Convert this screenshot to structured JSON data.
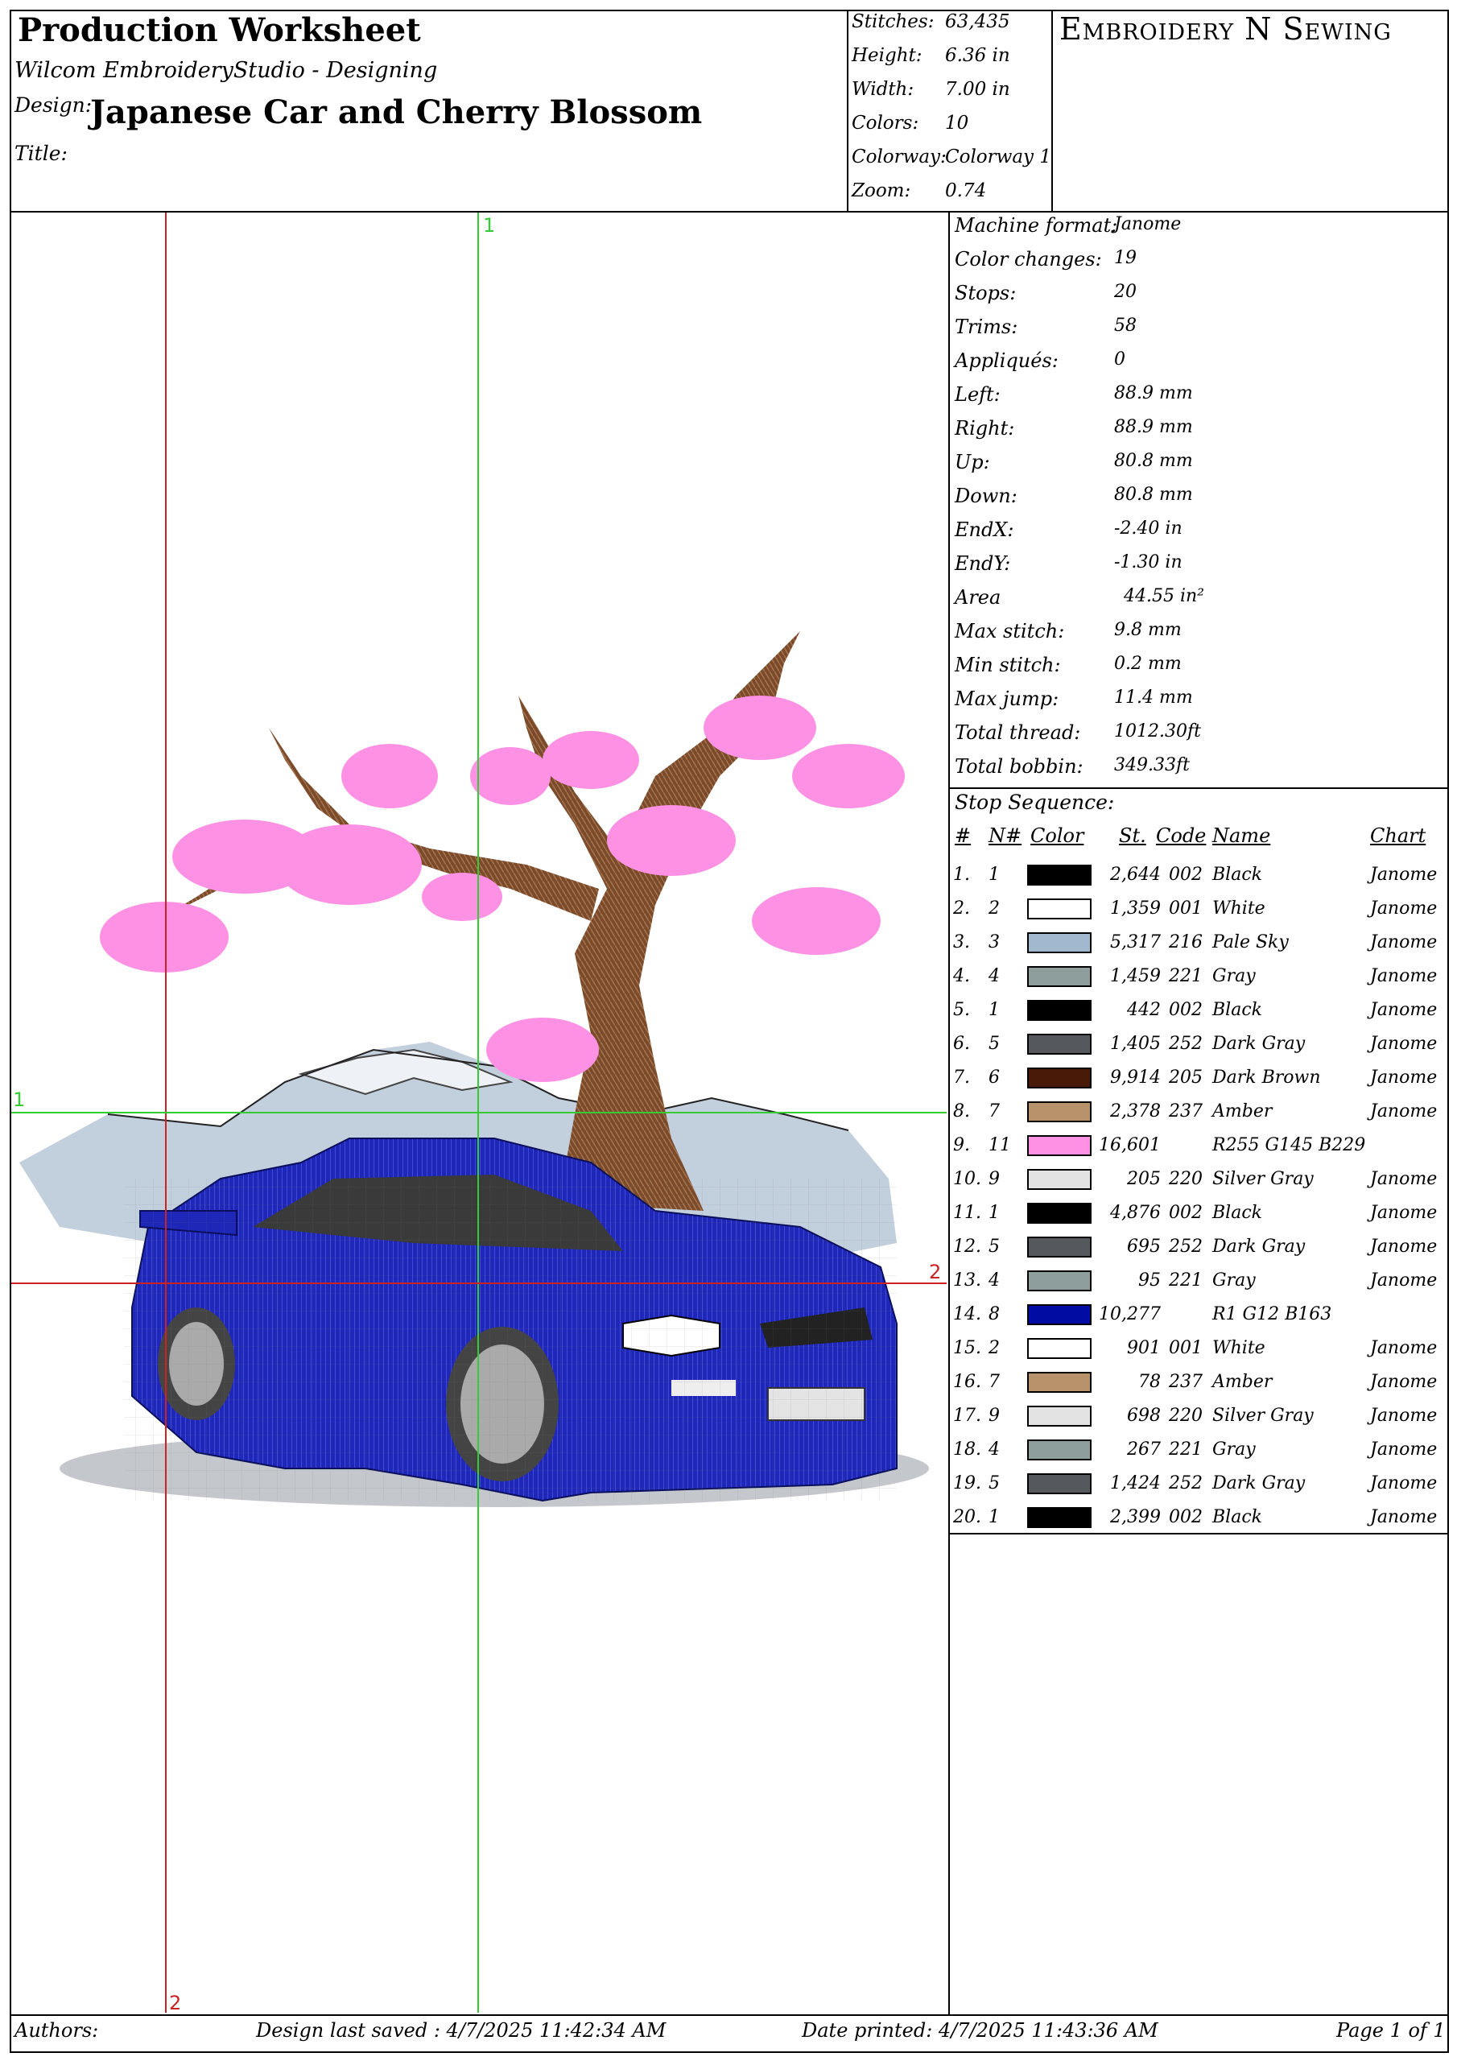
{
  "header": {
    "title": "Production Worksheet",
    "software": "Wilcom EmbroideryStudio - Designing",
    "design_label": "Design:",
    "design_name": "Japanese Car and Cherry Blossom",
    "title_label": "Title:",
    "brand": "Embroidery N Sewing"
  },
  "summary": [
    {
      "label": "Stitches:",
      "value": "63,435"
    },
    {
      "label": "Height:",
      "value": "6.36  in"
    },
    {
      "label": "Width:",
      "value": "7.00  in"
    },
    {
      "label": "Colors:",
      "value": "10"
    },
    {
      "label": "Colorway:",
      "value": "Colorway 1"
    },
    {
      "label": "Zoom:",
      "value": "0.74"
    }
  ],
  "machine_info": [
    {
      "label": "Machine format:",
      "value": "Janome"
    },
    {
      "label": "Color changes:",
      "value": "19"
    },
    {
      "label": "Stops:",
      "value": "20"
    },
    {
      "label": "Trims:",
      "value": "58"
    },
    {
      "label": "Appliqués:",
      "value": "0"
    },
    {
      "label": "Left:",
      "value": "88.9  mm"
    },
    {
      "label": "Right:",
      "value": "88.9  mm"
    },
    {
      "label": "Up:",
      "value": "80.8  mm"
    },
    {
      "label": "Down:",
      "value": "80.8  mm"
    },
    {
      "label": "EndX:",
      "value": "-2.40  in"
    },
    {
      "label": "EndY:",
      "value": "-1.30  in"
    },
    {
      "label": "Area",
      "value": "44.55  in²"
    },
    {
      "label": "Max stitch:",
      "value": "9.8  mm"
    },
    {
      "label": "Min stitch:",
      "value": "0.2  mm"
    },
    {
      "label": "Max jump:",
      "value": "11.4  mm"
    },
    {
      "label": "Total thread:",
      "value": "1012.30ft"
    },
    {
      "label": "Total bobbin:",
      "value": "349.33ft"
    }
  ],
  "stop_sequence": {
    "heading": "Stop Sequence:",
    "columns": {
      "idx": "#",
      "n": "N#",
      "color": "Color",
      "st": "St.",
      "code": "Code",
      "name": "Name",
      "chart": "Chart"
    },
    "rows": [
      {
        "idx": "1.",
        "n": "1",
        "color": "#000000",
        "st": "2,644",
        "code": "002",
        "name": "Black",
        "chart": "Janome"
      },
      {
        "idx": "2.",
        "n": "2",
        "color": "#ffffff",
        "st": "1,359",
        "code": "001",
        "name": "White",
        "chart": "Janome"
      },
      {
        "idx": "3.",
        "n": "3",
        "color": "#a0b9cf",
        "st": "5,317",
        "code": "216",
        "name": "Pale Sky",
        "chart": "Janome"
      },
      {
        "idx": "4.",
        "n": "4",
        "color": "#8e9e9c",
        "st": "1,459",
        "code": "221",
        "name": "Gray",
        "chart": "Janome"
      },
      {
        "idx": "5.",
        "n": "1",
        "color": "#000000",
        "st": "442",
        "code": "002",
        "name": "Black",
        "chart": "Janome"
      },
      {
        "idx": "6.",
        "n": "5",
        "color": "#55585c",
        "st": "1,405",
        "code": "252",
        "name": "Dark Gray",
        "chart": "Janome"
      },
      {
        "idx": "7.",
        "n": "6",
        "color": "#4a1a08",
        "st": "9,914",
        "code": "205",
        "name": "Dark Brown",
        "chart": "Janome"
      },
      {
        "idx": "8.",
        "n": "7",
        "color": "#b8926b",
        "st": "2,378",
        "code": "237",
        "name": "Amber",
        "chart": "Janome"
      },
      {
        "idx": "9.",
        "n": "11",
        "color": "#ff91e5",
        "st": "16,601",
        "code": "",
        "name": "R255 G145 B229",
        "chart": ""
      },
      {
        "idx": "10.",
        "n": "9",
        "color": "#e3e3e3",
        "st": "205",
        "code": "220",
        "name": "Silver Gray",
        "chart": "Janome"
      },
      {
        "idx": "11.",
        "n": "1",
        "color": "#000000",
        "st": "4,876",
        "code": "002",
        "name": "Black",
        "chart": "Janome"
      },
      {
        "idx": "12.",
        "n": "5",
        "color": "#55585c",
        "st": "695",
        "code": "252",
        "name": "Dark Gray",
        "chart": "Janome"
      },
      {
        "idx": "13.",
        "n": "4",
        "color": "#8e9e9c",
        "st": "95",
        "code": "221",
        "name": "Gray",
        "chart": "Janome"
      },
      {
        "idx": "14.",
        "n": "8",
        "color": "#010ca3",
        "st": "10,277",
        "code": "",
        "name": "R1 G12 B163",
        "chart": ""
      },
      {
        "idx": "15.",
        "n": "2",
        "color": "#ffffff",
        "st": "901",
        "code": "001",
        "name": "White",
        "chart": "Janome"
      },
      {
        "idx": "16.",
        "n": "7",
        "color": "#b8926b",
        "st": "78",
        "code": "237",
        "name": "Amber",
        "chart": "Janome"
      },
      {
        "idx": "17.",
        "n": "9",
        "color": "#e3e3e3",
        "st": "698",
        "code": "220",
        "name": "Silver Gray",
        "chart": "Janome"
      },
      {
        "idx": "18.",
        "n": "4",
        "color": "#8e9e9c",
        "st": "267",
        "code": "221",
        "name": "Gray",
        "chart": "Janome"
      },
      {
        "idx": "19.",
        "n": "5",
        "color": "#55585c",
        "st": "1,424",
        "code": "252",
        "name": "Dark Gray",
        "chart": "Janome"
      },
      {
        "idx": "20.",
        "n": "1",
        "color": "#000000",
        "st": "2,399",
        "code": "002",
        "name": "Black",
        "chart": "Janome"
      }
    ]
  },
  "preview": {
    "marker_v1": "1",
    "marker_v2": "2",
    "marker_h1": "1",
    "marker_h2": "2",
    "colors": {
      "guide_green": "#33cc33",
      "guide_red": "#cc2222",
      "car": "#1f27b8",
      "blossom": "#ff91e5",
      "trunk": "#7a4a2a"
    }
  },
  "footer": {
    "authors": "Authors:",
    "saved": "Design last saved : 4/7/2025 11:42:34 AM",
    "printed": "Date printed: 4/7/2025 11:43:36 AM",
    "page": "Page 1 of 1"
  }
}
